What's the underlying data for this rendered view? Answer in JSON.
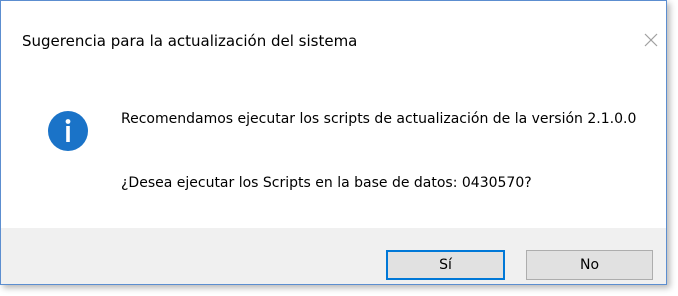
{
  "dialog": {
    "title": "Sugerencia para la actualización del sistema",
    "close_glyph": "✕",
    "icon": "information-icon",
    "message": "Recomendamos ejecutar los scripts de actualización de la versión 2.1.0.0",
    "question": "¿Desea ejecutar los Scripts en la base de datos: 0430570?",
    "buttons": {
      "yes_label": "Sí",
      "no_label": "No"
    }
  },
  "colors": {
    "window_border": "#5c8ed0",
    "info_icon": "#1a73c8",
    "footer_bg": "#f0f0f0",
    "default_button_border": "#0078d7"
  }
}
